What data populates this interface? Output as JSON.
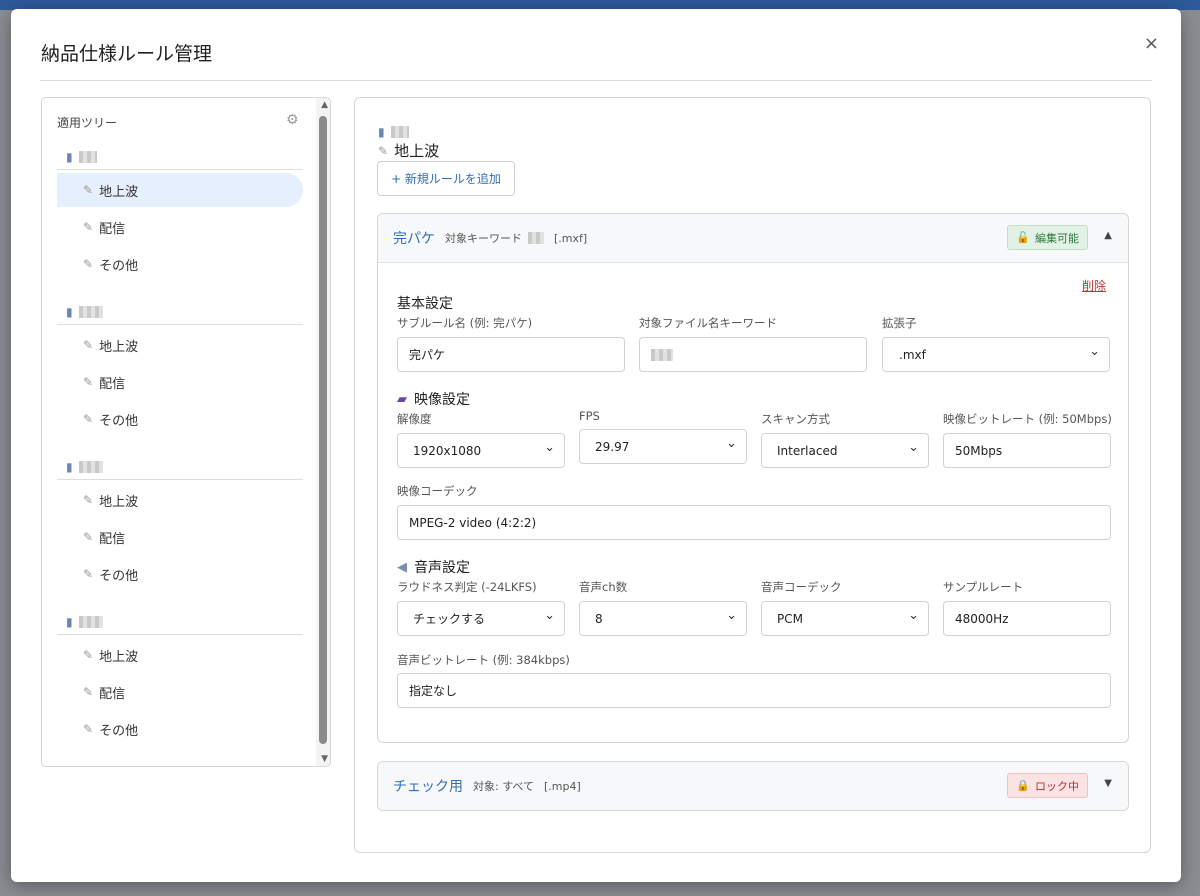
{
  "modal": {
    "title": "納品仕様ルール管理",
    "close": "×"
  },
  "tree": {
    "title": "適用ツリー",
    "groups": [
      {
        "items": [
          "地上波",
          "配信",
          "その他"
        ]
      },
      {
        "items": [
          "地上波",
          "配信",
          "その他"
        ]
      },
      {
        "items": [
          "地上波",
          "配信",
          "その他"
        ]
      },
      {
        "items": [
          "地上波",
          "配信",
          "その他"
        ]
      }
    ],
    "active": "地上波"
  },
  "main": {
    "crumb_leaf": "地上波",
    "add_button": "+ 新規ルールを追加",
    "rules": [
      {
        "name": "完パケ",
        "meta_prefix": "対象キーワード",
        "meta_ext": "[.mxf]",
        "badge": "編集可能",
        "expanded": true
      },
      {
        "name": "チェック用",
        "meta_prefix": "対象: すべて",
        "meta_ext": "[.mp4]",
        "badge": "ロック中",
        "expanded": false
      }
    ],
    "form": {
      "delete": "削除",
      "basic": {
        "title": "基本設定",
        "subrule_label": "サブルール名 (例: 完パケ)",
        "subrule_value": "完パケ",
        "keyword_label": "対象ファイル名キーワード",
        "ext_label": "拡張子",
        "ext_value": ".mxf"
      },
      "video": {
        "title": "映像設定",
        "resolution_label": "解像度",
        "resolution_value": "1920x1080",
        "fps_label": "FPS",
        "fps_value": "29.97",
        "scan_label": "スキャン方式",
        "scan_value": "Interlaced",
        "bitrate_label": "映像ビットレート (例: 50Mbps)",
        "bitrate_value": "50Mbps",
        "codec_label": "映像コーデック",
        "codec_value": "MPEG-2 video (4:2:2)"
      },
      "audio": {
        "title": "音声設定",
        "loudness_label": "ラウドネス判定 (-24LKFS)",
        "loudness_value": "チェックする",
        "ch_label": "音声ch数",
        "ch_value": "8",
        "codec_label": "音声コーデック",
        "codec_value": "PCM",
        "rate_label": "サンプルレート",
        "rate_value": "48000Hz",
        "bitrate_label": "音声ビットレート (例: 384kbps)",
        "bitrate_value": "指定なし"
      }
    }
  },
  "colors": {
    "accent": "#2f6fb8",
    "active_bg": "#e6effd",
    "ok": "#2d7a3e",
    "lock": "#b33030"
  }
}
